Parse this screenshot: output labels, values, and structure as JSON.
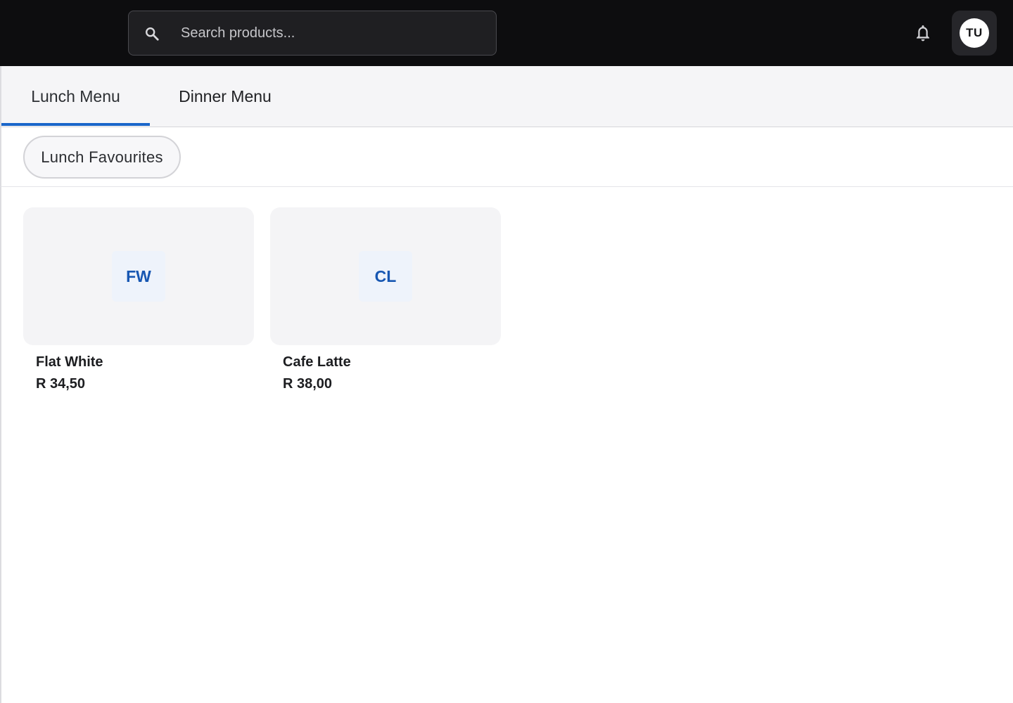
{
  "header": {
    "search": {
      "placeholder": "Search products...",
      "value": ""
    },
    "notifications_icon": "bell-icon",
    "avatar_initials": "TU"
  },
  "tabs": [
    {
      "label": "Lunch Menu",
      "active": true
    },
    {
      "label": "Dinner Menu",
      "active": false
    }
  ],
  "categories": [
    {
      "label": "Lunch Favourites",
      "selected": true
    }
  ],
  "products": [
    {
      "initials": "FW",
      "name": "Flat White",
      "price": "R 34,50"
    },
    {
      "initials": "CL",
      "name": "Cafe Latte",
      "price": "R 38,00"
    }
  ],
  "colors": {
    "accent": "#1a66c9",
    "topbar_bg": "#0d0d0f",
    "initials_text": "#1757b2"
  }
}
